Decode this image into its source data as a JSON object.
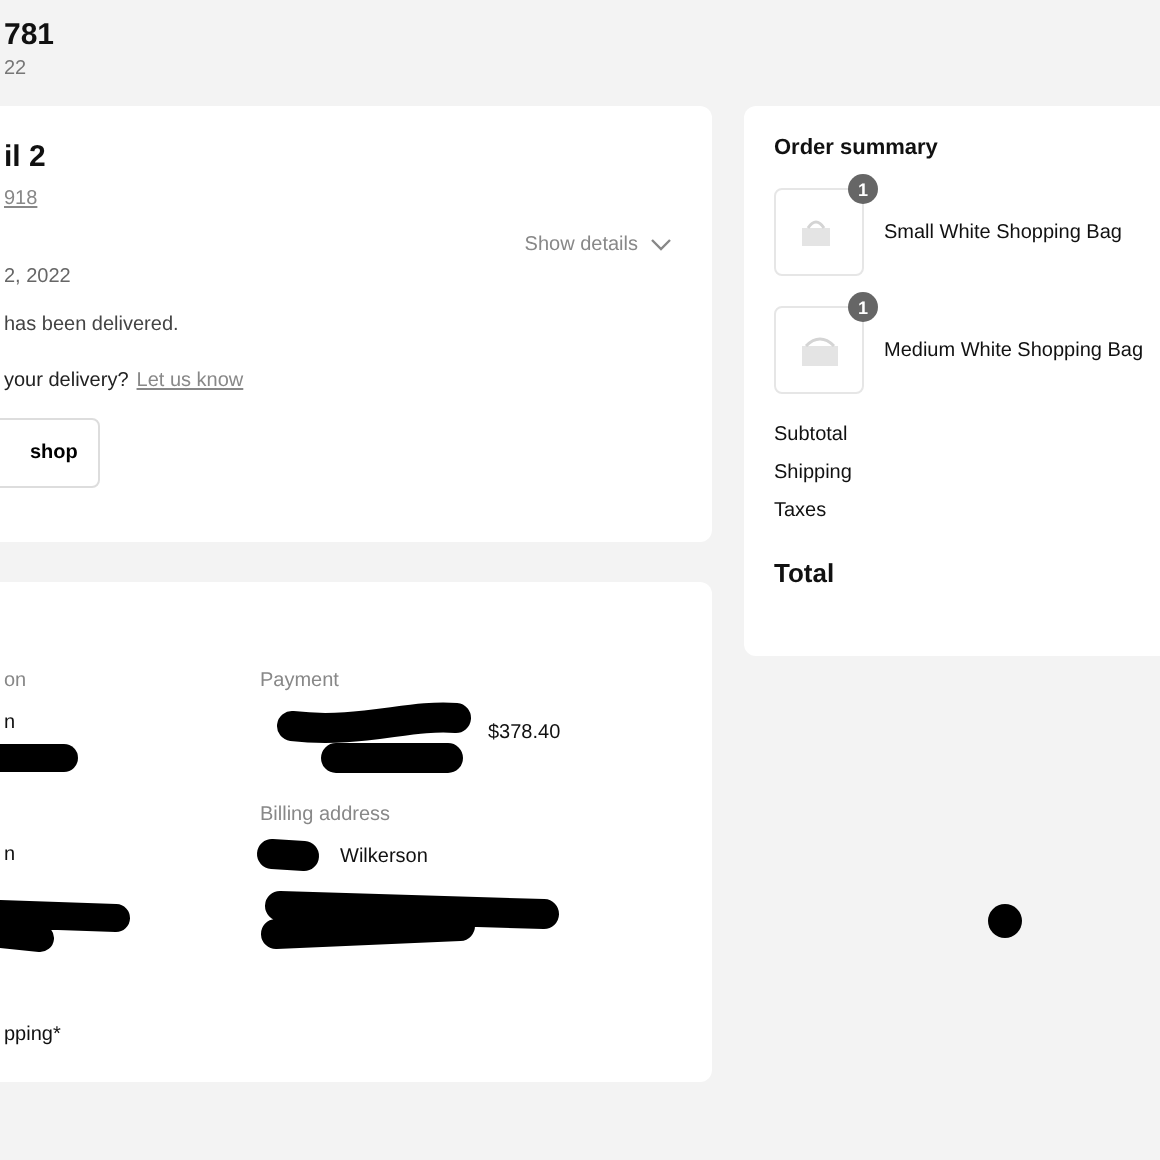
{
  "header": {
    "order_number": "781",
    "date": "22"
  },
  "fulfillment": {
    "title": "il 2",
    "tracking": "918",
    "details_toggle": "Show details",
    "date": "2, 2022",
    "status": "has been delivered.",
    "question": "your delivery?",
    "question_link": "Let us know",
    "button": "shop"
  },
  "info": {
    "label": "on",
    "values": [
      "n",
      "n"
    ],
    "note": "pping*",
    "payment": {
      "label": "Payment",
      "amount": "$378.40"
    },
    "billing": {
      "label": "Billing address",
      "name": "Wilkerson"
    }
  },
  "summary": {
    "title": "Order summary",
    "items": [
      {
        "name": "Small White Shopping Bag",
        "quantity": "1",
        "kind": "picture"
      },
      {
        "name": "Medium White Shopping Bag",
        "quantity": "1",
        "kind": "picture"
      }
    ],
    "rows": [
      "Subtotal",
      "Shipping",
      "Taxes"
    ],
    "total": "Total"
  }
}
